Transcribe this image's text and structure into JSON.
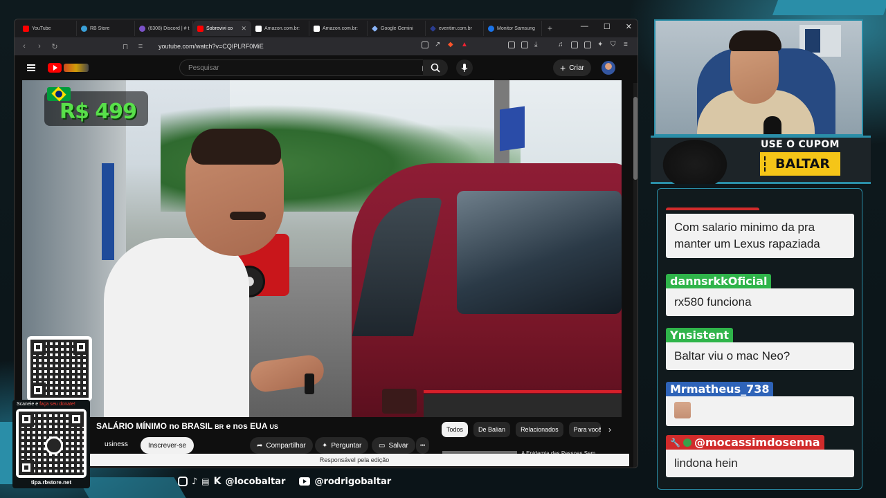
{
  "browser": {
    "tabs": [
      {
        "label": "YouTube",
        "color": "#ff0000",
        "active": false
      },
      {
        "label": "RB Store",
        "color": "#3aa0d8",
        "active": false
      },
      {
        "label": "(6308) Discord | # t",
        "color": "#7b52c8",
        "active": false
      },
      {
        "label": "Sobrevivi co",
        "color": "#ff0000",
        "active": true
      },
      {
        "label": "Amazon.com.br: ",
        "color": "#ffffff",
        "active": false
      },
      {
        "label": "Amazon.com.br: ",
        "color": "#ffffff",
        "active": false
      },
      {
        "label": "Google Gemini",
        "color": "#8ab4f8",
        "active": false
      },
      {
        "label": "eventim.com.br",
        "color": "#2a3c8f",
        "active": false
      },
      {
        "label": "Monitor Samsung",
        "color": "#1a73e8",
        "active": false
      }
    ],
    "new_tab": "+",
    "url": "youtube.com/watch?v=CQIPLRF0MiE"
  },
  "youtube": {
    "search_placeholder": "Pesquisar",
    "create_label": "Criar",
    "video": {
      "price_overlay": "R$ 499",
      "title_main": "SALÁRIO MÍNIMO no BRASIL",
      "title_br": "BR",
      "title_mid": "e nos EUA",
      "title_us": "US",
      "channel_fragment": "usiness",
      "subscribe_label": "Inscrever-se",
      "share_label": "Compartilhar",
      "ask_label": "Perguntar",
      "save_label": "Salvar",
      "more_label": "•••"
    },
    "chips": [
      "Todos",
      "De Balian",
      "Relacionados",
      "Para você"
    ],
    "tooltip": "Responsável pela edição",
    "rec_title": "A Epidemia das Pessoas Sem"
  },
  "overlay": {
    "qr_caption_prefix": "Scaneie e ",
    "qr_caption_accent": "faça seu donate!",
    "qr_url": "tipa.rbstore.net",
    "social_handle_1": "@locobaltar",
    "social_handle_2": "@rodrigobaltar",
    "coupon_label": "USE O CUPOM",
    "coupon_code": "BALTAR"
  },
  "chat": {
    "messages": [
      {
        "user": "",
        "name_color": "#d12b2b",
        "text": "Com salario minimo da pra manter um Lexus rapaziada"
      },
      {
        "user": "dannsrkkOficial",
        "name_color": "#2fb44a",
        "text": "rx580 funciona"
      },
      {
        "user": "Ynsistent",
        "name_color": "#2fb44a",
        "text": "Baltar viu o mac Neo?"
      },
      {
        "user": "Mrmatheus_738",
        "name_color": "#2e63b8",
        "text": ""
      },
      {
        "user": "@mocassimdosenna",
        "name_color": "#d12b2b",
        "text": "lindona hein"
      }
    ]
  }
}
